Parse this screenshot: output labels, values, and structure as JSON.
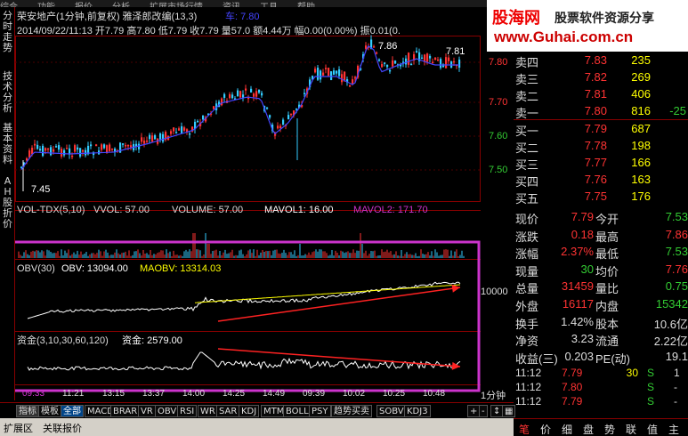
{
  "menu": [
    "综合",
    "功能",
    "报价",
    "分析",
    "扩展市场行情",
    "资讯",
    "工具",
    "帮助"
  ],
  "left_tabs": [
    "分时走势",
    "技术分析",
    "基本资料",
    "AH股折价"
  ],
  "chart": {
    "title": "荣安地产(1分钟,前复权) 雅泽郎改编(13,3)",
    "title_extra": "车: 7.80",
    "bar_info": "2014/09/22/11:13 开7.79 高7.80 低7.79 收7.79 量57.0 额4.44万 幅0.00(0.00%) 振0.01(0.",
    "price_labels": [
      "7.86",
      "7.81",
      "7.45"
    ],
    "price_axis": [
      "7.80",
      "7.70",
      "7.60",
      "7.50"
    ],
    "vol_info": {
      "name": "VOL-TDX(5,10)",
      "vvol": "VVOL: 57.00",
      "volume": "VOLUME: 57.00",
      "mavol1": "MAVOL1: 16.00",
      "mavol2": "MAVOL2: 171.70"
    },
    "obv_info": {
      "name": "OBV(30)",
      "obv": "OBV: 13094.00",
      "maobv": "MAOBV: 13314.03"
    },
    "obv_axis": "10000",
    "fund_info": {
      "name": "资金(3,10,30,60,120)",
      "value": "资金: 2579.00"
    },
    "time_axis": [
      "09:33",
      "11:21",
      "13:15",
      "13:37",
      "14:00",
      "14:25",
      "14:49",
      "09:39",
      "10:02",
      "10:25",
      "10:48"
    ],
    "time_label": "1分钟",
    "colors": {
      "up": "#ff3333",
      "down": "#33ccff",
      "ma": "#4444ff",
      "obv": "#ffffff",
      "maobv": "#ffff00",
      "highlight": "#cc33cc",
      "arrow": "#ff2222"
    }
  },
  "logo": {
    "cn": "股海网",
    "slogan": "股票软件资源分享",
    "url": "www.Guhai.com.cn"
  },
  "orderbook": {
    "asks": [
      {
        "label": "卖四",
        "price": "7.83",
        "vol": "235",
        "chg": ""
      },
      {
        "label": "卖三",
        "price": "7.82",
        "vol": "269",
        "chg": ""
      },
      {
        "label": "卖二",
        "price": "7.81",
        "vol": "406",
        "chg": ""
      },
      {
        "label": "卖一",
        "price": "7.80",
        "vol": "816",
        "chg": "-25"
      }
    ],
    "bids": [
      {
        "label": "买一",
        "price": "7.79",
        "vol": "687",
        "chg": ""
      },
      {
        "label": "买二",
        "price": "7.78",
        "vol": "198",
        "chg": ""
      },
      {
        "label": "买三",
        "price": "7.77",
        "vol": "166",
        "chg": ""
      },
      {
        "label": "买四",
        "price": "7.76",
        "vol": "163",
        "chg": ""
      },
      {
        "label": "买五",
        "price": "7.75",
        "vol": "176",
        "chg": ""
      }
    ]
  },
  "stats": [
    {
      "l1": "现价",
      "v1": "7.79",
      "l2": "今开",
      "v2": "7.53"
    },
    {
      "l1": "涨跌",
      "v1": "0.18",
      "l2": "最高",
      "v2": "7.86"
    },
    {
      "l1": "涨幅",
      "v1": "2.37%",
      "l2": "最低",
      "v2": "7.53"
    },
    {
      "l1": "现量",
      "v1": "30",
      "l2": "均价",
      "v2": "7.76"
    },
    {
      "l1": "总量",
      "v1": "31459",
      "l2": "量比",
      "v2": "0.75"
    },
    {
      "l1": "外盘",
      "v1": "16117",
      "l2": "内盘",
      "v2": "15342"
    },
    {
      "l1": "换手",
      "v1": "1.42%",
      "l2": "股本",
      "v2": "10.6亿"
    },
    {
      "l1": "净资",
      "v1": "3.23",
      "l2": "流通",
      "v2": "2.22亿"
    },
    {
      "l1": "收益(三)",
      "v1": "0.203",
      "l2": "PE(动)",
      "v2": "19.1"
    }
  ],
  "ticks": [
    {
      "time": "11:12",
      "price": "7.79",
      "vol": "30",
      "side": "S",
      "n": "1"
    },
    {
      "time": "11:12",
      "price": "7.80",
      "vol": "",
      "side": "S",
      "n": "-"
    },
    {
      "time": "11:12",
      "price": "7.79",
      "vol": "",
      "side": "S",
      "n": "-"
    }
  ],
  "bottom_tabs": [
    "指标",
    "模板",
    "全部",
    "MACD",
    "BRAR",
    "VR",
    "OBV",
    "RSI",
    "WR",
    "SAR",
    "KDJ",
    "MTM",
    "BOLL",
    "PSY",
    "趋势买卖",
    "SOBV",
    "KDJ3"
  ],
  "status": [
    "扩展区",
    "关联报价"
  ],
  "right_tabs": [
    "笔",
    "价",
    "细",
    "盘",
    "势",
    "联",
    "值",
    "主"
  ]
}
